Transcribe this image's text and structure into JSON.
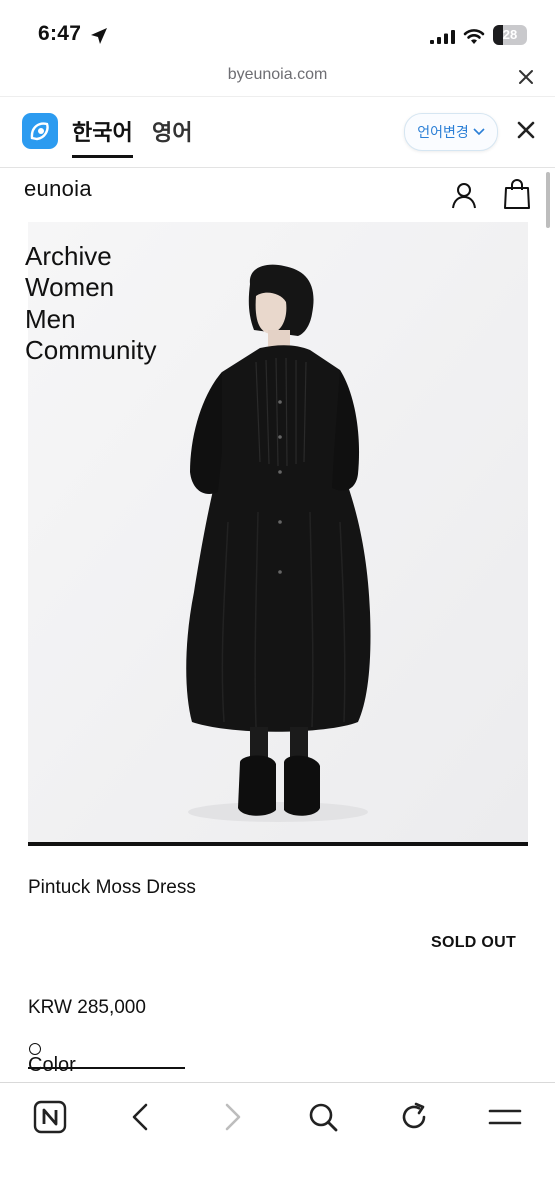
{
  "status_bar": {
    "time": "6:47",
    "battery_level": "28",
    "battery_percent": 0.28
  },
  "browser": {
    "url": "byeunoia.com"
  },
  "translate_bar": {
    "source_lang": "한국어",
    "target_lang": "영어",
    "change_language": "언어변경"
  },
  "site": {
    "logo": "eunoia",
    "nav": [
      "Archive",
      "Women",
      "Men",
      "Community"
    ]
  },
  "product": {
    "name": "Pintuck Moss Dress",
    "status": "SOLD OUT",
    "price": "KRW 285,000",
    "option_label": "Color"
  },
  "colors": {
    "accent_blue": "#2b7fd6",
    "papago_blue": "#2c9bf0"
  },
  "toolbar": {
    "icons": [
      "naver-icon",
      "back-icon",
      "forward-icon",
      "search-icon",
      "reload-icon",
      "menu-icon"
    ]
  }
}
